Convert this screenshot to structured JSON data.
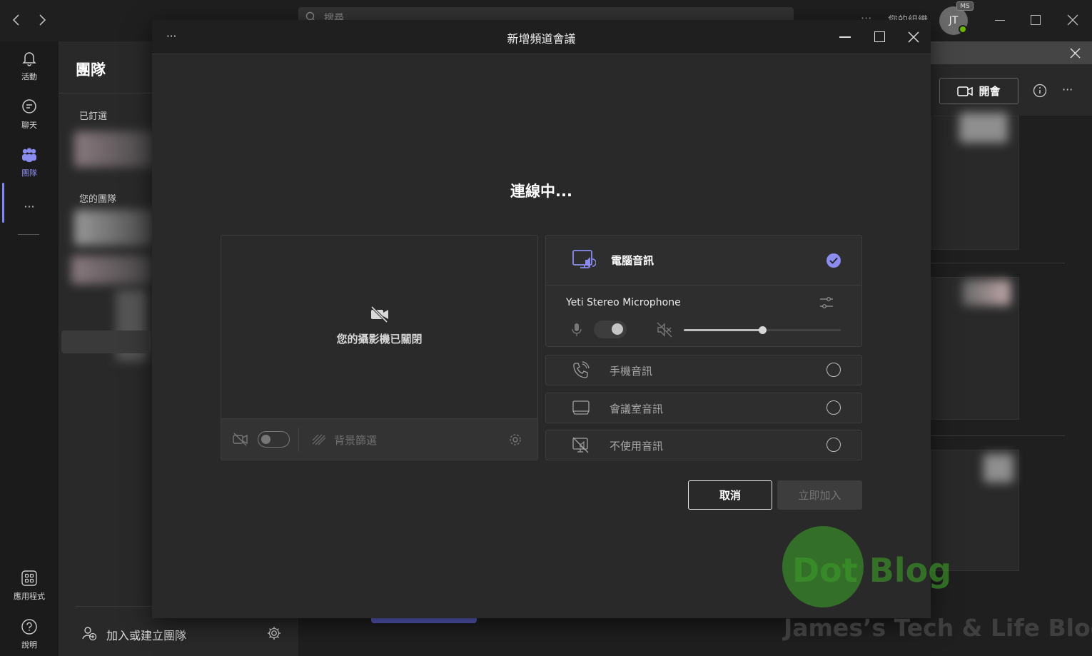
{
  "window": {
    "title": "新增頻道會議"
  },
  "topbar": {
    "search_placeholder": "搜尋",
    "org_label": "您的組織",
    "avatar_initials": "JT",
    "avatar_badge": "MS"
  },
  "rail": {
    "items": [
      {
        "label": "活動",
        "icon": "bell-icon"
      },
      {
        "label": "聊天",
        "icon": "chat-icon"
      },
      {
        "label": "團隊",
        "icon": "teams-icon"
      },
      {
        "label": "應用程式",
        "icon": "apps-icon"
      },
      {
        "label": "說明",
        "icon": "help-icon"
      }
    ]
  },
  "teams_panel": {
    "title": "團隊",
    "pinned_label": "已釘選",
    "your_teams_label": "您的團隊",
    "join_create_label": "加入或建立團隊"
  },
  "channel_header": {
    "meet_label": "開會"
  },
  "dialog": {
    "status": "連線中...",
    "camera": {
      "off_text": "您的攝影機已關閉",
      "background_filter_label": "背景篩選",
      "camera_on": false
    },
    "audio": {
      "computer_audio_label": "電腦音訊",
      "computer_audio_selected": true,
      "device_name": "Yeti Stereo Microphone",
      "mic_on": false,
      "speaker_level": 0.5,
      "phone_audio_label": "手機音訊",
      "room_audio_label": "會議室音訊",
      "no_audio_label": "不使用音訊"
    },
    "cancel_label": "取消",
    "join_label": "立即加入"
  },
  "watermark": {
    "logo": "Dot Blog",
    "tagline": "James’s Tech & Life Blog"
  },
  "colors": {
    "accent": "#7f85f5",
    "background": "#1f1f1f",
    "dialog": "#292929"
  }
}
